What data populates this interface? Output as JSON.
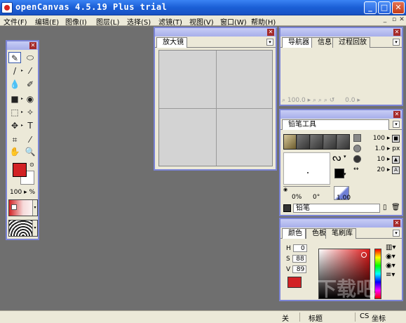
{
  "window": {
    "title": "openCanvas 4.5.19 Plus trial",
    "controls": {
      "minimize": "_",
      "maximize": "□",
      "close": "✕"
    }
  },
  "menu": {
    "items": [
      "文件(F)",
      "编辑(E)",
      "图像(I)",
      "图层(L)",
      "选择(S)",
      "滤镜(T)",
      "视图(V)",
      "窗口(W)",
      "帮助(H)"
    ]
  },
  "toolbox": {
    "tools": [
      [
        "pencil-tool",
        "ellipse-tool"
      ],
      [
        "brush-tool",
        "airbrush-tool"
      ],
      [
        "water-tool",
        "eraser-tool"
      ],
      [
        "fill-tool",
        "blur-tool"
      ],
      [
        "select-rect-tool",
        "magic-wand-tool"
      ],
      [
        "move-tool",
        "text-tool"
      ],
      [
        "crop-tool",
        "eyedropper-tool"
      ],
      [
        "hand-tool",
        "zoom-tool"
      ]
    ],
    "opacity_value": "100",
    "opacity_unit": "%"
  },
  "magnifier": {
    "tab": "放大镜"
  },
  "navigator": {
    "tabs": [
      "导航器",
      "信息",
      "过程回放"
    ],
    "zoom": "100.0",
    "angle": "0.0"
  },
  "brush": {
    "tab": "铅笔工具",
    "params": [
      {
        "value": "100",
        "unit": "%"
      },
      {
        "value": "1.0",
        "unit": "px"
      },
      {
        "value": "10",
        "unit": "%"
      },
      {
        "value": "20",
        "unit": "%"
      }
    ],
    "angle_left": "0%",
    "angle_right": "0°",
    "density": "1.00",
    "preset_name": "铅笔"
  },
  "color": {
    "tabs": [
      "颜色",
      "色板",
      "笔刷库"
    ],
    "h_label": "H",
    "h_value": "0",
    "s_label": "S",
    "s_value": "88",
    "v_label": "V",
    "v_value": "89",
    "current": "#d22224"
  },
  "status": {
    "off": "关",
    "title_label": "标题",
    "cs": "CS",
    "coord_label": "坐标"
  },
  "watermark": "下载吧"
}
